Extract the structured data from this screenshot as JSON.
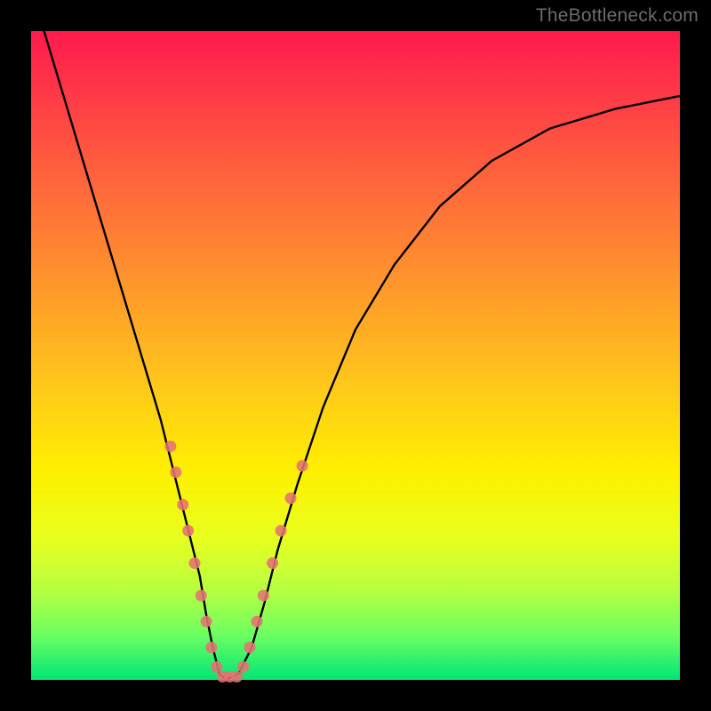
{
  "watermark": "TheBottleneck.com",
  "chart_data": {
    "type": "line",
    "title": "",
    "xlabel": "",
    "ylabel": "",
    "xlim": [
      0,
      100
    ],
    "ylim": [
      0,
      100
    ],
    "grid": false,
    "series": [
      {
        "name": "bottleneck-curve",
        "x": [
          2,
          5,
          8,
          11,
          14,
          17,
          20,
          22,
          24,
          26,
          27,
          28,
          29,
          30,
          32,
          34,
          36,
          38,
          41,
          45,
          50,
          56,
          63,
          71,
          80,
          90,
          100
        ],
        "y": [
          100,
          90,
          80,
          70,
          60,
          50,
          40,
          32,
          24,
          16,
          10,
          5,
          1,
          0,
          1,
          5,
          12,
          20,
          30,
          42,
          54,
          64,
          73,
          80,
          85,
          88,
          90
        ]
      }
    ],
    "markers": {
      "name": "highlight-dots",
      "color": "#e57373",
      "points": [
        {
          "x": 21.5,
          "y": 36
        },
        {
          "x": 22.3,
          "y": 32
        },
        {
          "x": 23.4,
          "y": 27
        },
        {
          "x": 24.2,
          "y": 23
        },
        {
          "x": 25.2,
          "y": 18
        },
        {
          "x": 26.2,
          "y": 13
        },
        {
          "x": 27.0,
          "y": 9
        },
        {
          "x": 27.8,
          "y": 5
        },
        {
          "x": 28.6,
          "y": 2
        },
        {
          "x": 29.5,
          "y": 0.5
        },
        {
          "x": 30.6,
          "y": 0.5
        },
        {
          "x": 31.7,
          "y": 0.5
        },
        {
          "x": 32.7,
          "y": 2
        },
        {
          "x": 33.7,
          "y": 5
        },
        {
          "x": 34.8,
          "y": 9
        },
        {
          "x": 35.8,
          "y": 13
        },
        {
          "x": 37.2,
          "y": 18
        },
        {
          "x": 38.5,
          "y": 23
        },
        {
          "x": 40.0,
          "y": 28
        },
        {
          "x": 41.8,
          "y": 33
        }
      ]
    }
  }
}
